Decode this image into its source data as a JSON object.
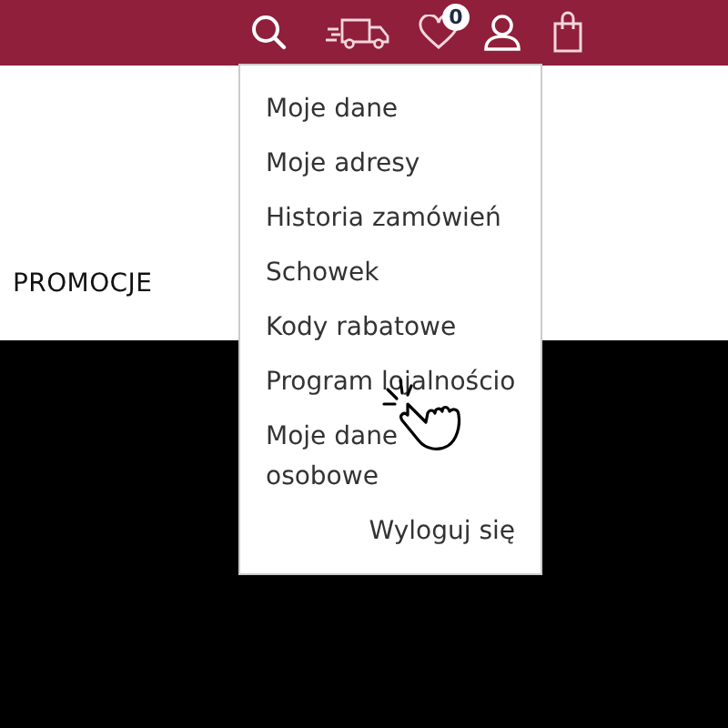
{
  "header": {
    "wishlist_count": "0"
  },
  "nav": {
    "label": "PROMOCJE"
  },
  "account_menu": {
    "items": [
      {
        "label": "Moje dane"
      },
      {
        "label": "Moje adresy"
      },
      {
        "label": "Historia zamówień"
      },
      {
        "label": "Schowek"
      },
      {
        "label": "Kody rabatowe"
      },
      {
        "label": "Program lojalnościo"
      },
      {
        "label": "Moje dane osobowe"
      }
    ],
    "logout": "Wyloguj się"
  }
}
